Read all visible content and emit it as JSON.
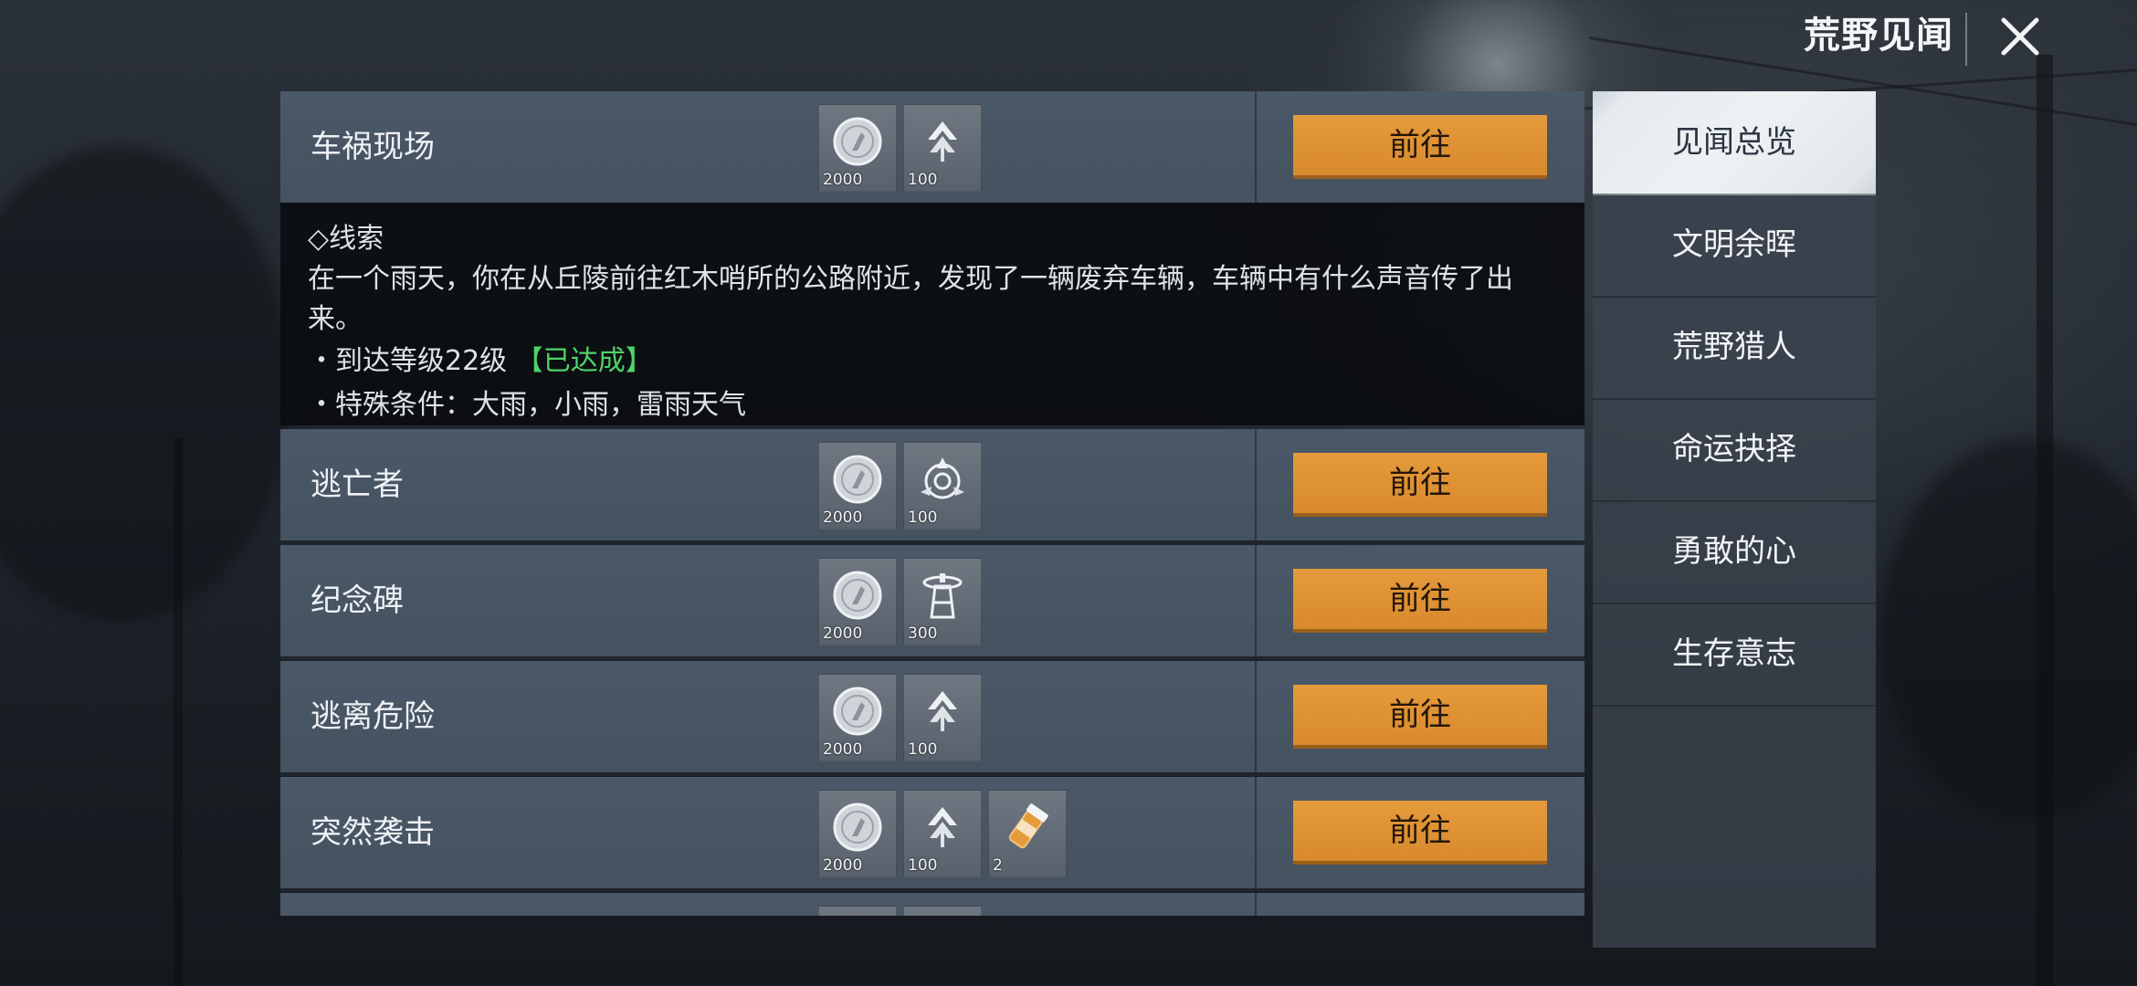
{
  "header": {
    "title": "荒野见闻"
  },
  "rows": [
    {
      "title": "车祸现场",
      "rewards": [
        {
          "icon": "silver-coin-icon",
          "qty": "2000"
        },
        {
          "icon": "wing-emblem-icon",
          "qty": "100"
        }
      ],
      "button": "前往"
    },
    {
      "title": "逃亡者",
      "rewards": [
        {
          "icon": "silver-coin-icon",
          "qty": "2000"
        },
        {
          "icon": "target-emblem-icon",
          "qty": "100"
        }
      ],
      "button": "前往"
    },
    {
      "title": "纪念碑",
      "rewards": [
        {
          "icon": "silver-coin-icon",
          "qty": "2000"
        },
        {
          "icon": "tower-emblem-icon",
          "qty": "300"
        }
      ],
      "button": "前往"
    },
    {
      "title": "逃离危险",
      "rewards": [
        {
          "icon": "silver-coin-icon",
          "qty": "2000"
        },
        {
          "icon": "wing-emblem-icon",
          "qty": "100"
        }
      ],
      "button": "前往"
    },
    {
      "title": "突然袭击",
      "rewards": [
        {
          "icon": "silver-coin-icon",
          "qty": "2000"
        },
        {
          "icon": "wing-emblem-icon",
          "qty": "100"
        },
        {
          "icon": "pill-bottle-icon",
          "qty": "2"
        }
      ],
      "button": "前往"
    }
  ],
  "detail": {
    "heading": "◇线索",
    "description_line1": "在一个雨天，你在从丘陵前往红木哨所的公路附近，发现了一辆废弃车辆，车辆中有什么声音传了出",
    "description_line2": "来。",
    "condition1": "・到达等级22级",
    "condition1_status": "【已达成】",
    "condition2": "・特殊条件：大雨，小雨，雷雨天气"
  },
  "sidebar": {
    "items": [
      {
        "label": "见闻总览",
        "active": true
      },
      {
        "label": "文明余晖",
        "active": false
      },
      {
        "label": "荒野猎人",
        "active": false
      },
      {
        "label": "命运抉择",
        "active": false
      },
      {
        "label": "勇敢的心",
        "active": false
      },
      {
        "label": "生存意志",
        "active": false
      }
    ]
  },
  "colors": {
    "accent_button": "#dd8f31",
    "achieved_green": "#4fd36a",
    "row_bg": "#48565f",
    "sidebar_active": "#e6eaee"
  }
}
